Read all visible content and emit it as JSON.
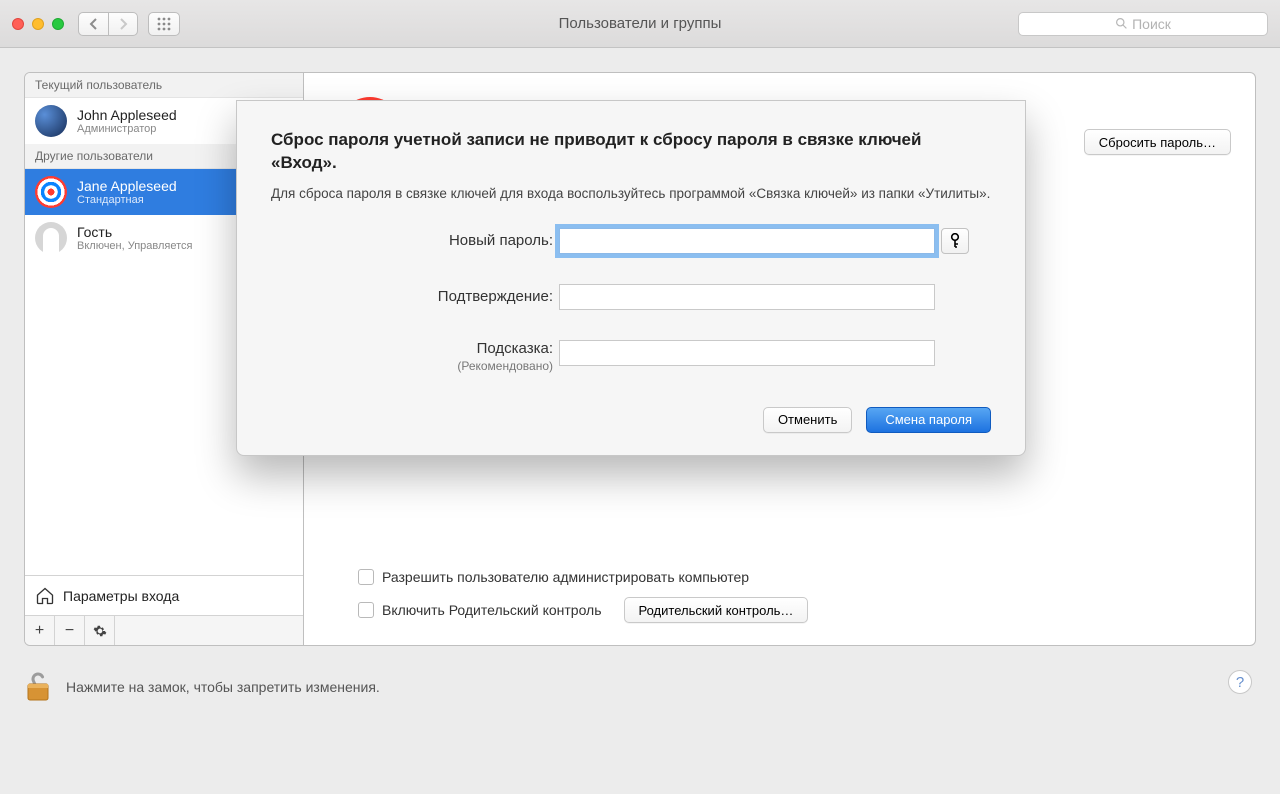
{
  "titlebar": {
    "title": "Пользователи и группы",
    "search_placeholder": "Поиск"
  },
  "sidebar": {
    "section_current": "Текущий пользователь",
    "section_others": "Другие пользователи",
    "current_user": {
      "name": "John Appleseed",
      "role": "Администратор"
    },
    "others": [
      {
        "name": "Jane Appleseed",
        "role": "Стандартная"
      },
      {
        "name": "Гость",
        "role": "Включен, Управляется"
      }
    ],
    "login_options": "Параметры входа"
  },
  "detail": {
    "name": "Jane Appleseed",
    "type": "Стандартная",
    "reset_btn": "Сбросить пароль…",
    "allow_admin": "Разрешить пользователю администрировать компьютер",
    "parental_cb": "Включить Родительский контроль",
    "parental_btn": "Родительский контроль…"
  },
  "lock": {
    "text": "Нажмите на замок, чтобы запретить изменения."
  },
  "sheet": {
    "title": "Сброс пароля учетной записи не приводит к сбросу пароля в связке ключей «Вход».",
    "desc": "Для сброса пароля в связке ключей для входа воспользуйтесь программой «Связка ключей» из папки «Утилиты».",
    "new_pw": "Новый пароль:",
    "confirm": "Подтверждение:",
    "hint": "Подсказка:",
    "hint_sub": "(Рекомендовано)",
    "cancel": "Отменить",
    "change": "Смена пароля"
  }
}
